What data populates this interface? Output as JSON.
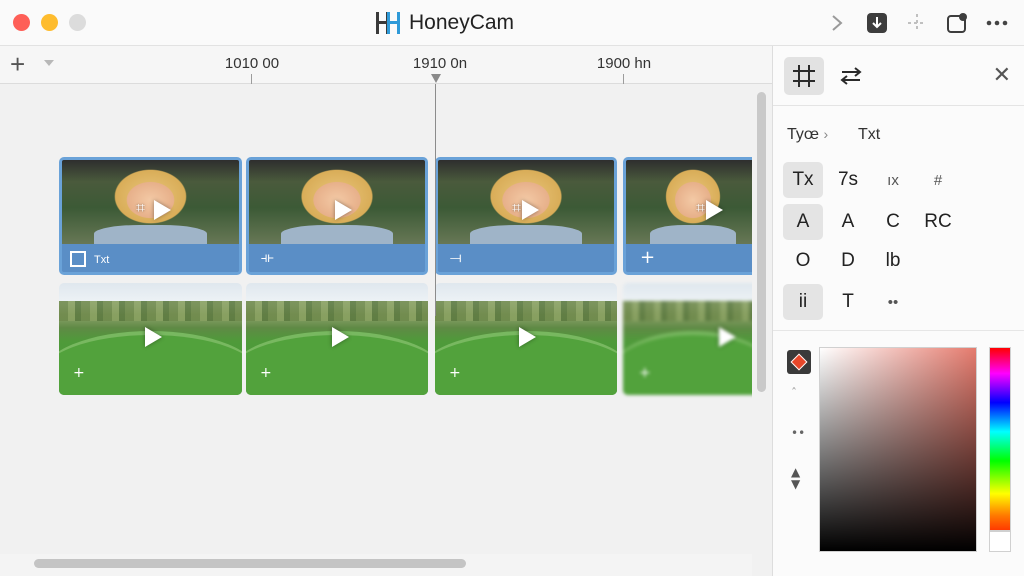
{
  "window": {
    "title": "HoneyCam"
  },
  "toolbar": {
    "next_icon": "chevron-right-icon",
    "export_icon": "download-box-icon",
    "move_icon": "move-icon",
    "share_icon": "share-window-icon",
    "more_icon": "more-dots-icon"
  },
  "timeline": {
    "add_label": "+",
    "ticks": [
      {
        "label": "1010 00"
      },
      {
        "label": "1910 0n"
      },
      {
        "label": "1900 hn"
      }
    ],
    "clip_caption": "Txt"
  },
  "panel": {
    "close_label": "✕",
    "breadcrumb": {
      "type_label": "Tyœ",
      "sep": "›",
      "current": "Txt"
    },
    "text_styles": [
      [
        "Tx",
        "7s",
        "ıx",
        "#"
      ],
      [
        "A",
        "A",
        "C",
        "RC"
      ],
      [
        "O",
        "D",
        "lb"
      ],
      [
        "ii",
        "T",
        "••"
      ]
    ],
    "color": {
      "current": "#e8472a"
    }
  }
}
